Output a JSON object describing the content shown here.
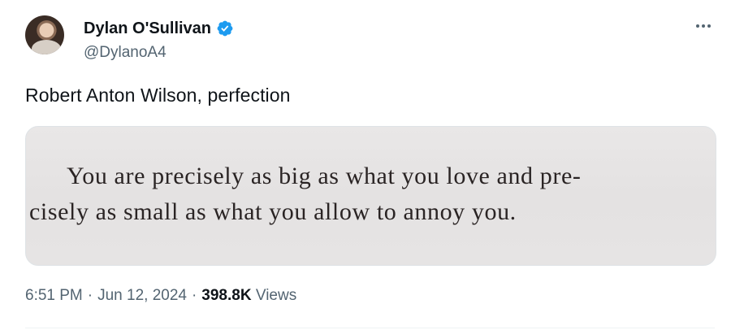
{
  "author": {
    "display_name": "Dylan O'Sullivan",
    "handle": "@DylanoA4",
    "verified_color": "#1d9bf0"
  },
  "tweet": {
    "text": "Robert Anton Wilson, perfection",
    "media": {
      "quote_line_1": "You are precisely as big as what you love and pre-",
      "quote_line_2": "cisely as small as what you allow to annoy you."
    }
  },
  "meta": {
    "time": "6:51 PM",
    "separator": "·",
    "date": "Jun 12, 2024",
    "views_count": "398.8K",
    "views_label": "Views"
  },
  "icons": {
    "verified": "verified-badge-icon",
    "more": "more-options-icon"
  }
}
